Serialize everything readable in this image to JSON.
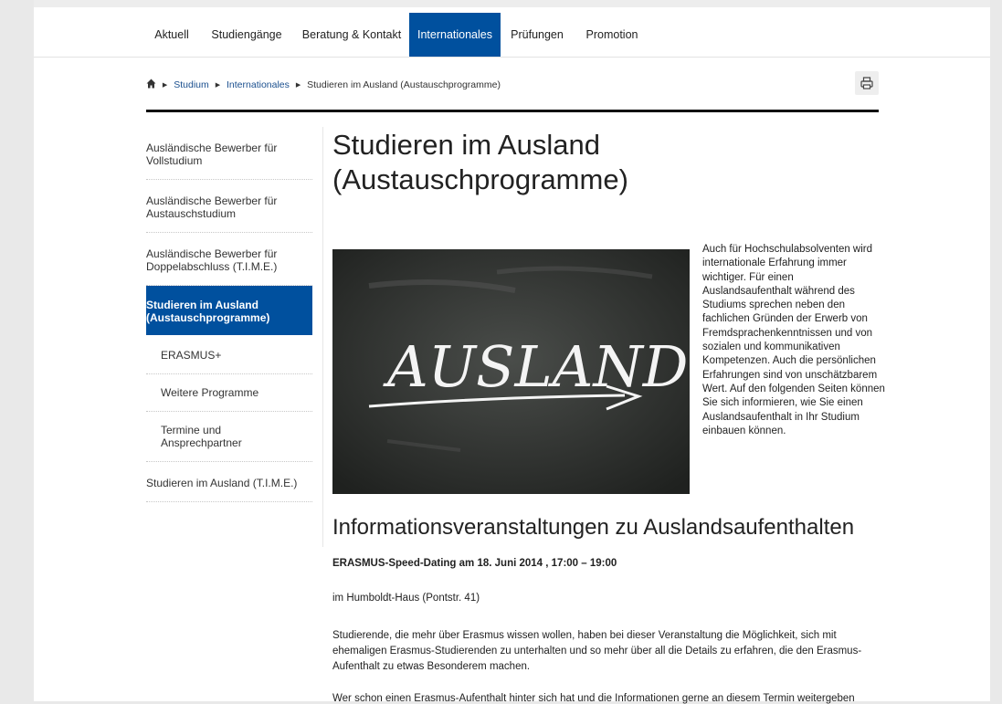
{
  "nav": {
    "items": [
      {
        "label": "Aktuell"
      },
      {
        "label": "Studiengänge"
      },
      {
        "label": "Beratung & Kontakt"
      },
      {
        "label": "Internationales",
        "active": true
      },
      {
        "label": "Prüfungen"
      },
      {
        "label": "Promotion"
      }
    ]
  },
  "breadcrumb": {
    "home_icon": "home-icon",
    "items": [
      "Studium",
      "Internationales",
      "Studieren im Ausland (Austauschprogramme)"
    ]
  },
  "toolbar": {
    "print_icon": "print-icon"
  },
  "sidebar": {
    "items": [
      {
        "label": "Ausländische Bewerber für Vollstudium"
      },
      {
        "label": "Ausländische Bewerber für Austauschstudium"
      },
      {
        "label": "Ausländische Bewerber für Doppelabschluss (T.I.M.E.)"
      },
      {
        "label": "Studieren im Ausland (Austauschprogramme)",
        "active": true
      },
      {
        "label": "ERASMUS+"
      },
      {
        "label": "Weitere Programme"
      },
      {
        "label": "Termine und Ansprechpartner"
      },
      {
        "label": "Studieren im Ausland (T.I.M.E.)"
      }
    ]
  },
  "main": {
    "title": "Studieren im Ausland (Austauschprogramme)",
    "hero_text": "AUSLAND",
    "intro": "Auch für Hochschulabsolventen wird internationale Erfahrung immer wichtiger. Für einen Auslandsaufenthalt während des Studiums sprechen neben den fachlichen Gründen der Erwerb von Fremdsprachenkenntnissen und von sozialen und kommunikativen Kompetenzen. Auch die persönlichen Erfahrungen sind von unschätzbarem Wert. Auf den folgenden Seiten können Sie sich informieren, wie Sie einen Auslandsaufenthalt in Ihr Studium einbauen können.",
    "section_title": "Informationsveranstaltungen zu Auslandsaufenthalten",
    "event_title": "ERASMUS-Speed-Dating am 18. Juni 2014 , 17:00 – 19:00",
    "event_place": "im Humboldt-Haus (Pontstr. 41)",
    "event_desc": "Studierende, die mehr über Erasmus wissen wollen, haben bei dieser Veranstaltung die Möglichkeit, sich mit ehemaligen Erasmus-Studierenden zu unterhalten und so mehr über all die Details zu erfahren, die den Erasmus-Aufenthalt zu etwas Besonderem machen.",
    "event_more": "Wer schon einen Erasmus-Aufenthalt hinter sich hat und die Informationen gerne an diesem Termin weitergeben"
  },
  "colors": {
    "accent": "#00509e",
    "text": "#222222",
    "link": "#1a4f8e"
  }
}
